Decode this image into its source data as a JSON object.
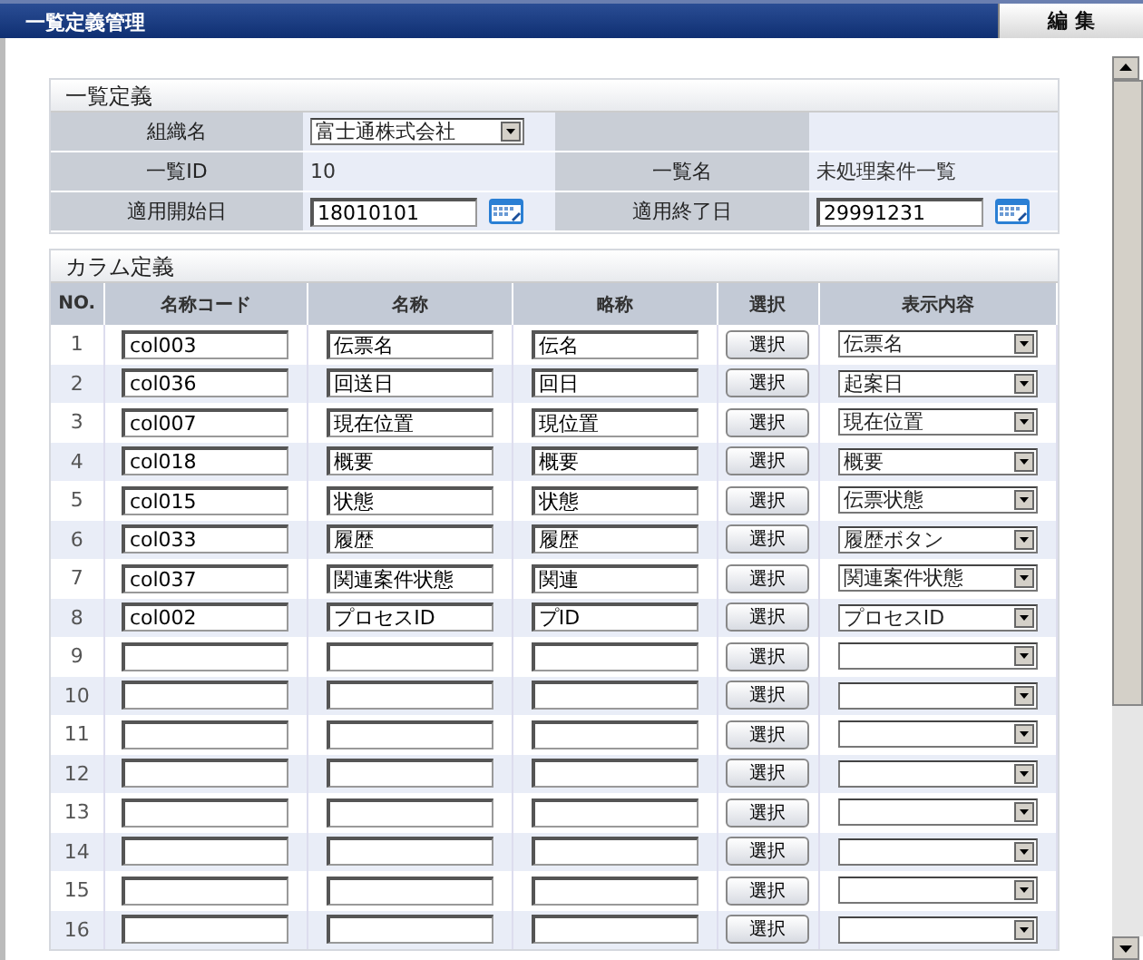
{
  "window": {
    "title": "一覧定義管理",
    "edit_button": "編 集"
  },
  "list_definition": {
    "title": "一覧定義",
    "fields": [
      {
        "kind": "dropdown",
        "label": "組織名",
        "value": "富士通株式会社"
      },
      {
        "kind": "empty"
      },
      {
        "kind": "text",
        "label": "一覧ID",
        "value": "10"
      },
      {
        "kind": "text",
        "label": "一覧名",
        "value": "未処理案件一覧"
      },
      {
        "kind": "date",
        "label": "適用開始日",
        "value": "18010101"
      },
      {
        "kind": "date",
        "label": "適用終了日",
        "value": "29991231"
      }
    ]
  },
  "column_definition": {
    "title": "カラム定義",
    "columns": [
      "NO.",
      "名称コード",
      "名称",
      "略称",
      "選択",
      "表示内容"
    ],
    "rows": [
      {
        "no": "1",
        "code": "col003",
        "name": "伝票名",
        "short": "伝名",
        "button": "選択",
        "display": "伝票名"
      },
      {
        "no": "2",
        "code": "col036",
        "name": "回送日",
        "short": "回日",
        "button": "選択",
        "display": "起案日"
      },
      {
        "no": "3",
        "code": "col007",
        "name": "現在位置",
        "short": "現位置",
        "button": "選択",
        "display": "現在位置"
      },
      {
        "no": "4",
        "code": "col018",
        "name": "概要",
        "short": "概要",
        "button": "選択",
        "display": "概要"
      },
      {
        "no": "5",
        "code": "col015",
        "name": "状態",
        "short": "状態",
        "button": "選択",
        "display": "伝票状態"
      },
      {
        "no": "6",
        "code": "col033",
        "name": "履歴",
        "short": "履歴",
        "button": "選択",
        "display": "履歴ボタン"
      },
      {
        "no": "7",
        "code": "col037",
        "name": "関連案件状態",
        "short": "関連",
        "button": "選択",
        "display": "関連案件状態"
      },
      {
        "no": "8",
        "code": "col002",
        "name": "プロセスID",
        "short": "プID",
        "button": "選択",
        "display": "プロセスID"
      },
      {
        "no": "9",
        "button": "選択"
      },
      {
        "no": "10",
        "button": "選択"
      },
      {
        "no": "11",
        "button": "選択"
      },
      {
        "no": "12",
        "button": "選択"
      },
      {
        "no": "13",
        "button": "選択"
      },
      {
        "no": "14",
        "button": "選択"
      },
      {
        "no": "15",
        "button": "選択"
      },
      {
        "no": "16",
        "button": "選択"
      }
    ]
  }
}
